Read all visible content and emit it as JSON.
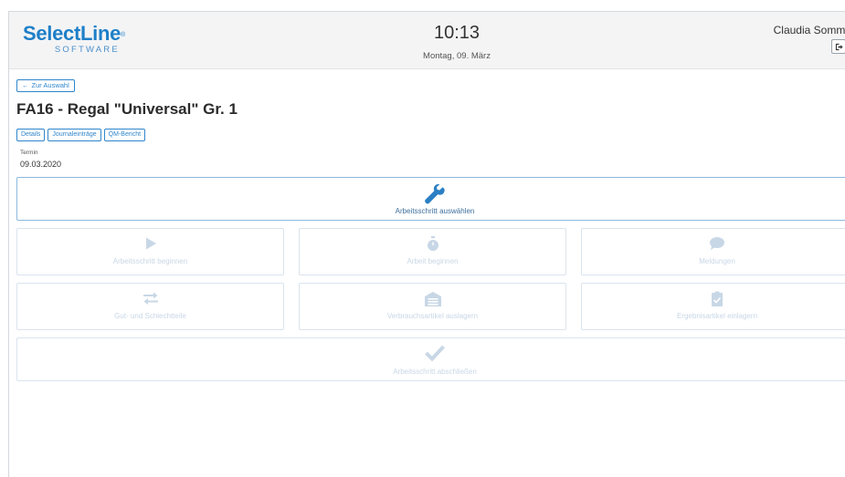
{
  "header": {
    "logo_main": "SelectLine",
    "logo_reg": "®",
    "logo_sub": "SOFTWARE",
    "time": "10:13",
    "date": "Montag, 09. März",
    "user_name": "Claudia Somme",
    "logout_icon": "logout-icon"
  },
  "back_button": {
    "label": "Zur Auswahl",
    "icon": "arrow-left-icon"
  },
  "order": {
    "title": "FA16 - Regal \"Universal\" Gr. 1"
  },
  "tabs": [
    {
      "label": "Details"
    },
    {
      "label": "Journaleinträge"
    },
    {
      "label": "QM-Bericht"
    }
  ],
  "termin": {
    "label": "Termin",
    "value": "09.03.2020"
  },
  "actions": {
    "select_step": {
      "label": "Arbeitsschritt auswählen",
      "icon": "wrench-icon",
      "enabled": true
    },
    "begin_step": {
      "label": "Arbeitsschritt beginnen",
      "icon": "play-icon",
      "enabled": false
    },
    "begin_work": {
      "label": "Arbeit beginnen",
      "icon": "stopwatch-icon",
      "enabled": false
    },
    "messages": {
      "label": "Meldungen",
      "icon": "speech-bubble-icon",
      "enabled": false
    },
    "good_bad_parts": {
      "label": "Gut- und Schlechtteile",
      "icon": "exchange-arrows-icon",
      "enabled": false
    },
    "consumables_out": {
      "label": "Verbrauchsartikel auslagern",
      "icon": "warehouse-icon",
      "enabled": false
    },
    "results_in": {
      "label": "Ergebnisartikel einlagern",
      "icon": "clipboard-check-icon",
      "enabled": false
    },
    "finish_step": {
      "label": "Arbeitsschritt abschließen",
      "icon": "checkmark-icon",
      "enabled": false
    }
  },
  "colors": {
    "brand_blue": "#1e7fc8",
    "accent": "#2f86cc",
    "active_icon": "#2a7fc4",
    "disabled": "#c8d7e6",
    "header_bg": "#f4f4f5"
  }
}
